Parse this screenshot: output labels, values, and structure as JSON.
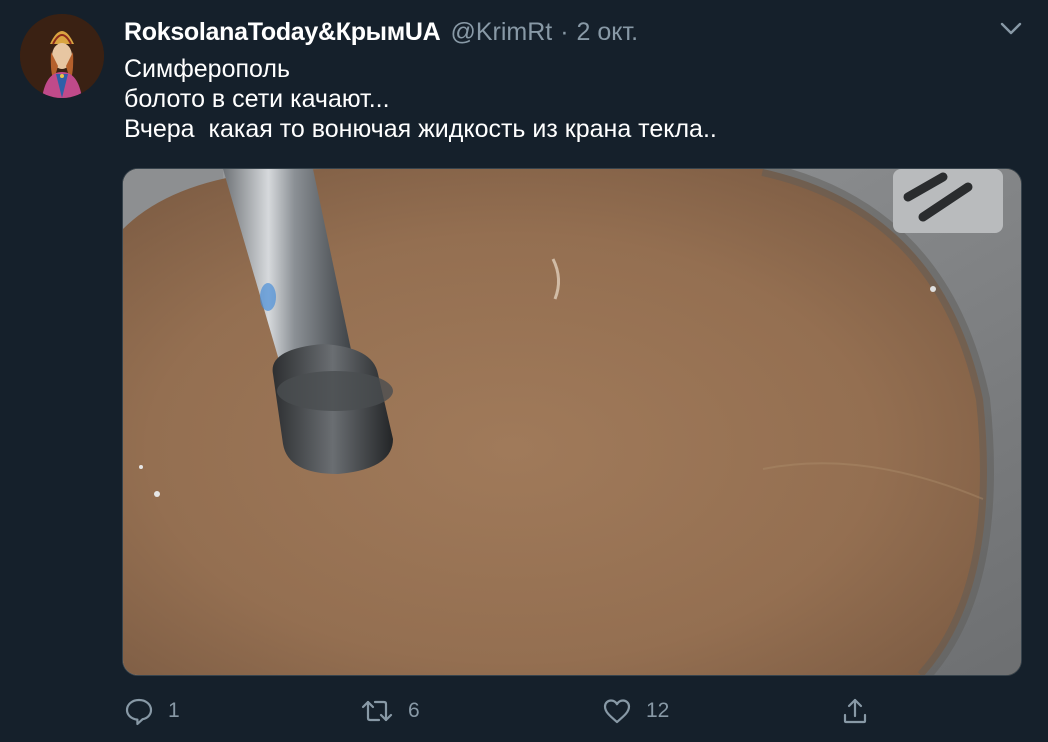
{
  "tweet": {
    "display_name": "RoksolanaToday&КрымUA",
    "handle": "@KrimRt",
    "separator": "·",
    "date": "2 окт.",
    "text_lines": [
      "Симферополь",
      "болото в сети качают...",
      "Вчера  какая то вонючая жидкость из крана текла.."
    ]
  },
  "actions": {
    "reply": {
      "icon": "reply-icon",
      "count": "1"
    },
    "retweet": {
      "icon": "retweet-icon",
      "count": "6"
    },
    "like": {
      "icon": "heart-icon",
      "count": "12"
    },
    "share": {
      "icon": "share-icon"
    }
  },
  "colors": {
    "background": "#15202b",
    "secondary_text": "#8899a6",
    "primary_text": "#ffffff",
    "media_border": "#38444d"
  }
}
